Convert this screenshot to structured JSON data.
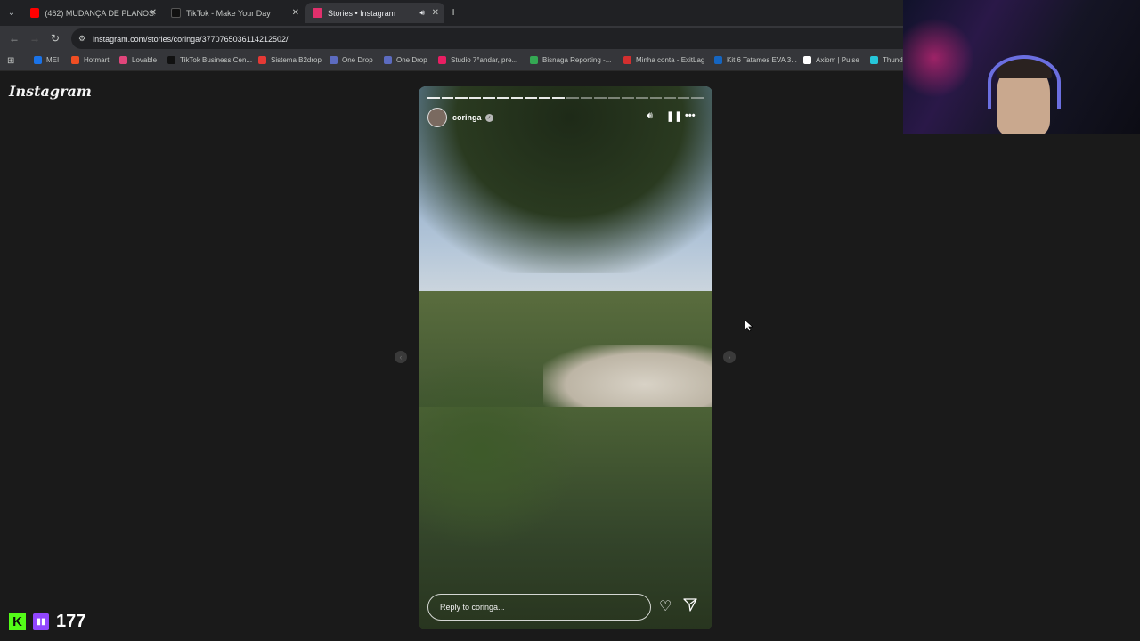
{
  "browser": {
    "tabs": [
      {
        "label": "(462) MUDANÇA DE PLANOS: (",
        "icon": "youtube-icon",
        "color": "#ff0000"
      },
      {
        "label": "TikTok - Make Your Day",
        "icon": "tiktok-icon",
        "color": "#111111"
      },
      {
        "label": "Stories • Instagram",
        "icon": "instagram-icon",
        "color": "#e1306c"
      }
    ],
    "url": "instagram.com/stories/coringa/3770765036114212502/",
    "bookmarks": [
      {
        "label": "MEI",
        "color": "#1a73e8"
      },
      {
        "label": "Hotmart",
        "color": "#f04e23"
      },
      {
        "label": "Lovable",
        "color": "#e0457b"
      },
      {
        "label": "TikTok Business Cen...",
        "color": "#111111"
      },
      {
        "label": "Sistema B2drop",
        "color": "#e53935"
      },
      {
        "label": "One Drop",
        "color": "#5c6bc0"
      },
      {
        "label": "One Drop",
        "color": "#5c6bc0"
      },
      {
        "label": "Studio 7°andar, pre...",
        "color": "#e91e63"
      },
      {
        "label": "Bisnaga Reporting -...",
        "color": "#34a853"
      },
      {
        "label": "Minha conta - ExitLag",
        "color": "#d32f2f"
      },
      {
        "label": "Kit 6 Tatames EVA 3...",
        "color": "#1565c0"
      },
      {
        "label": "Axiom | Pulse",
        "color": "#ffffff"
      },
      {
        "label": "Thunde",
        "color": "#26c6da"
      }
    ]
  },
  "instagram": {
    "logo": "Instagram",
    "story": {
      "username": "coringa",
      "reply_placeholder": "Reply to coringa...",
      "progress_total": 20,
      "progress_done": 10
    }
  },
  "stream": {
    "viewer_count": "177",
    "kick_brand_color": "#53fc18",
    "twitch_brand_color": "#9146ff"
  }
}
